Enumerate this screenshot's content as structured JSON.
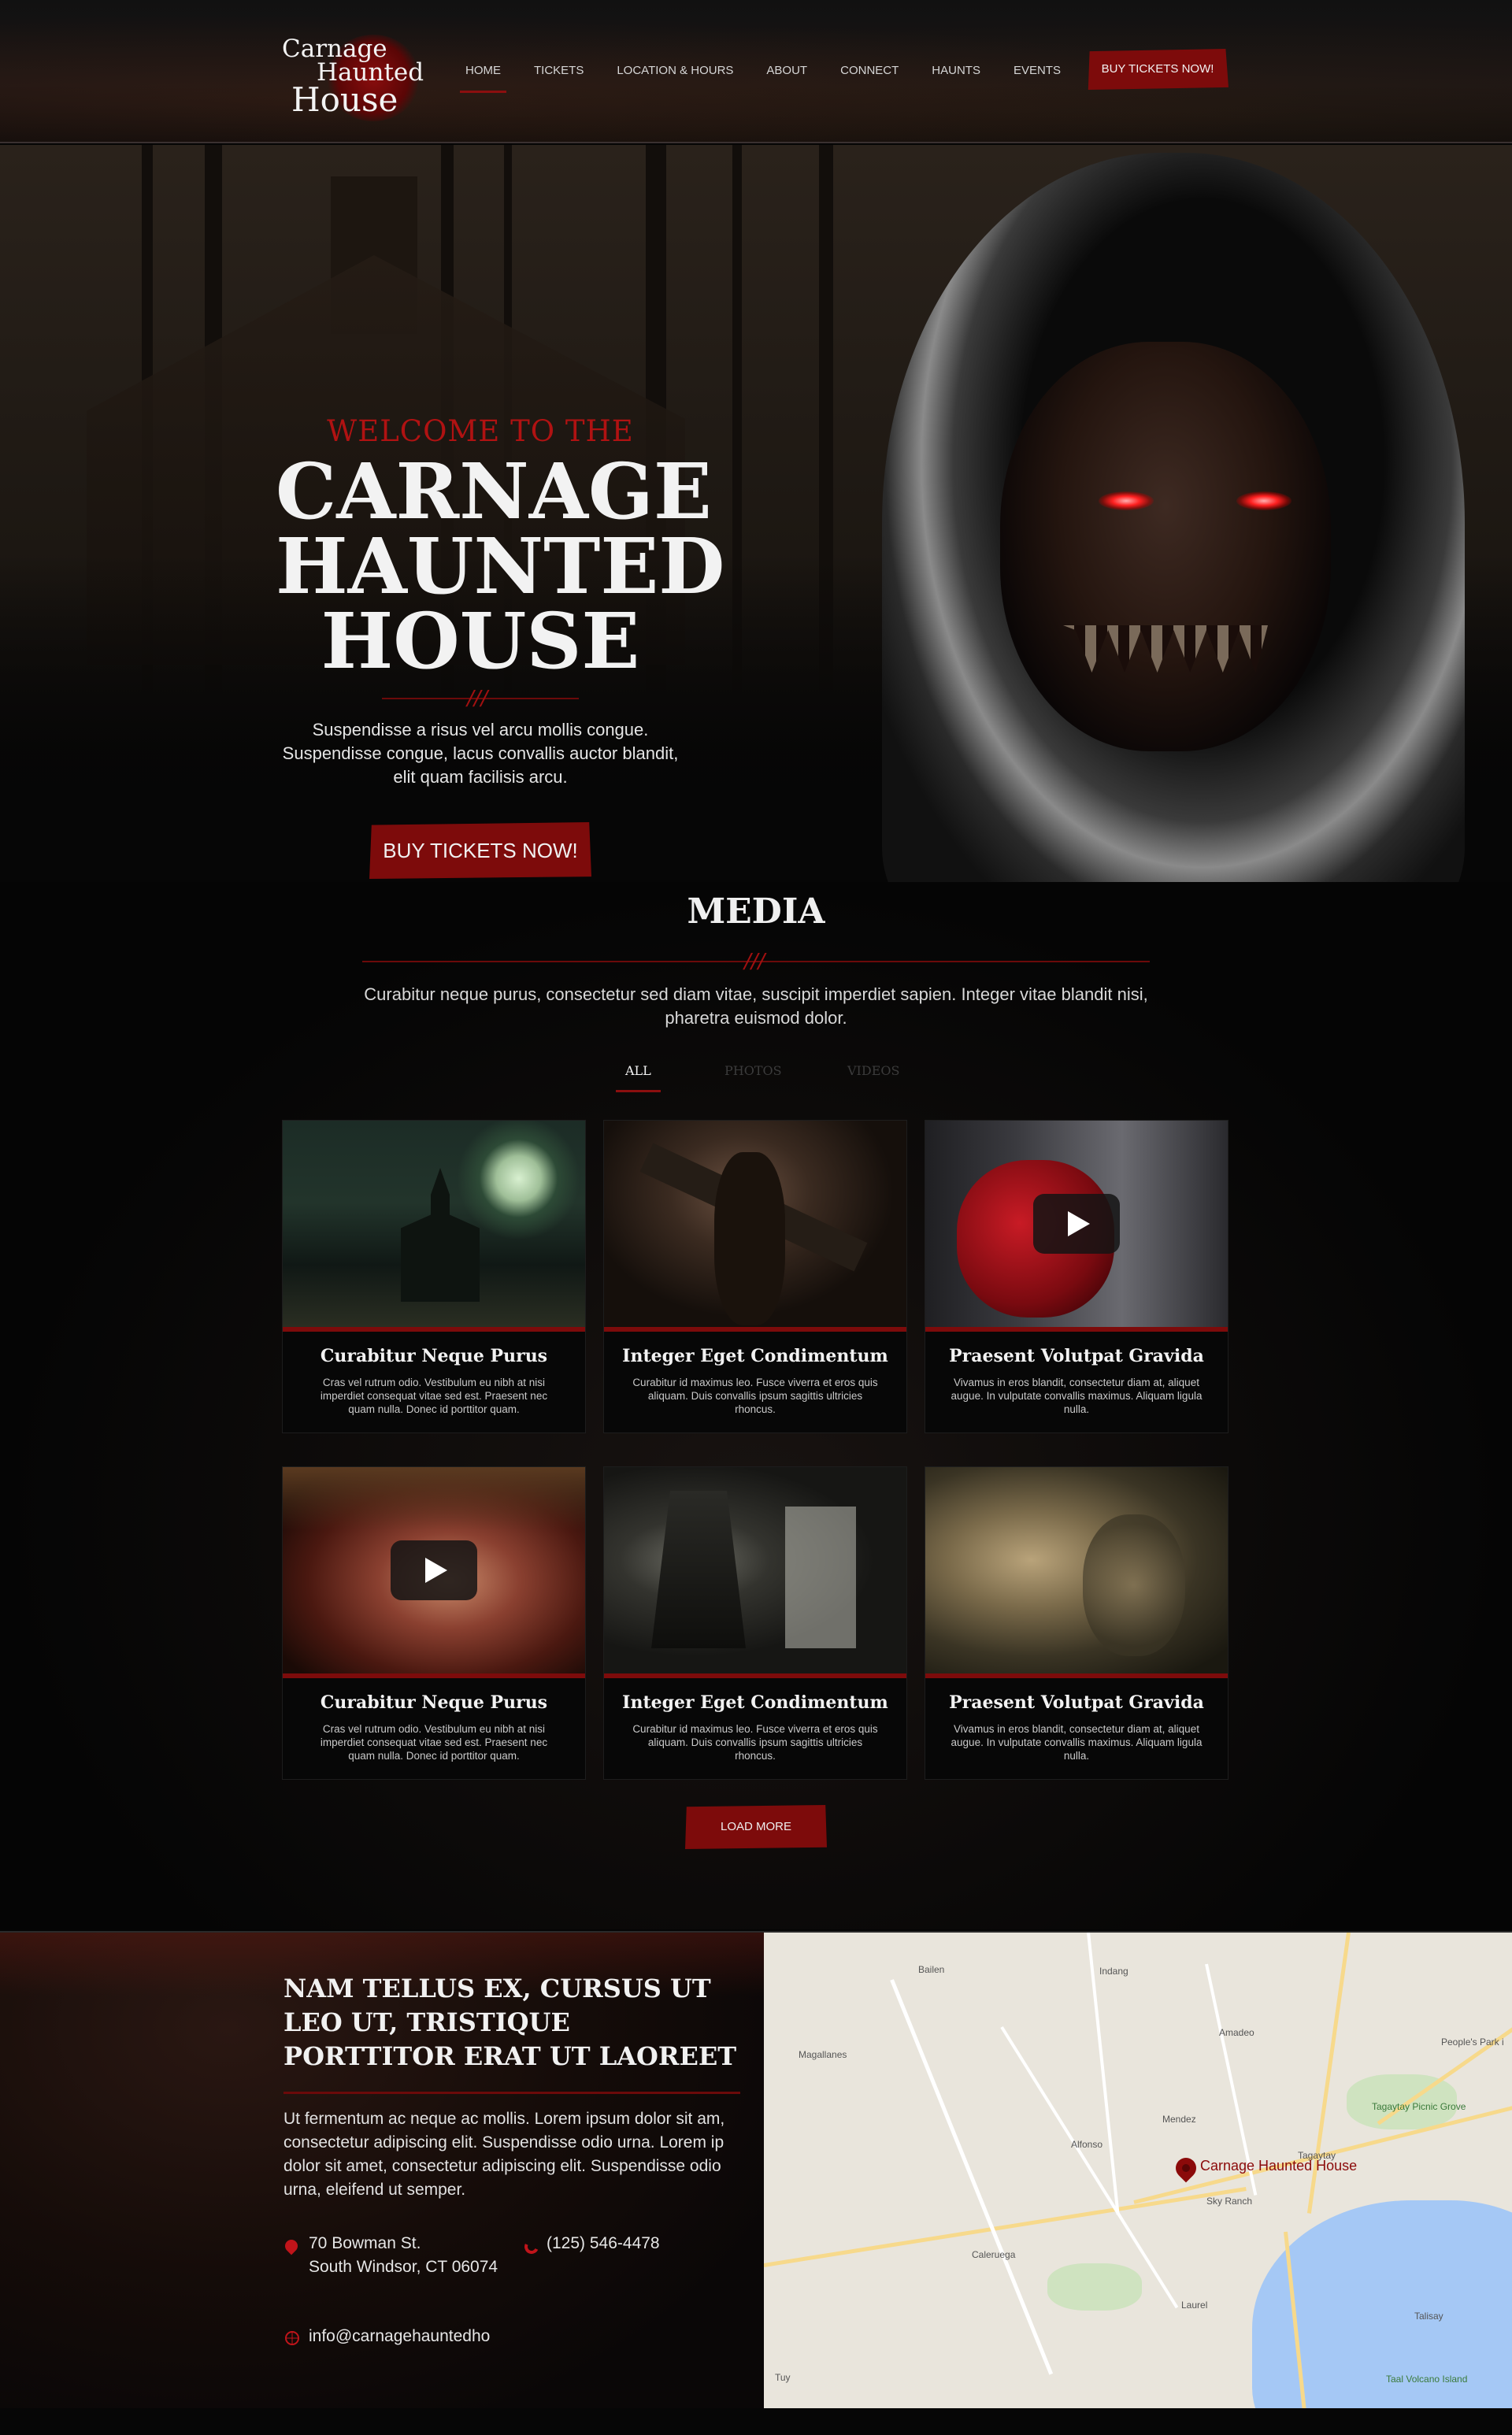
{
  "header": {
    "logo": {
      "line1": "Carnage",
      "line2": "Haunted",
      "line3": "House"
    },
    "nav": [
      "HOME",
      "TICKETS",
      "LOCATION & HOURS",
      "ABOUT",
      "CONNECT",
      "HAUNTS",
      "EVENTS"
    ],
    "buy_button": "BUY TICKETS NOW!"
  },
  "hero": {
    "kicker": "WELCOME TO THE",
    "title_lines": [
      "CARNAGE",
      "HAUNTED",
      "HOUSE"
    ],
    "divider_marks": "///",
    "description": "Suspendisse a risus vel arcu mollis congue. Suspendisse congue, lacus convallis auctor blandit, elit quam facilisis arcu.",
    "button": "BUY TICKETS NOW!"
  },
  "media": {
    "title": "MEDIA",
    "divider_marks": "///",
    "description": "Curabitur neque purus, consectetur sed diam vitae, suscipit imperdiet sapien. Integer vitae blandit nisi, pharetra euismod dolor.",
    "filters": [
      "ALL",
      "PHOTOS",
      "VIDEOS"
    ],
    "active_filter": "ALL",
    "items": [
      {
        "title": "Curabitur Neque Purus",
        "text": "Cras vel rutrum odio. Vestibulum eu nibh at nisi imperdiet consequat vitae sed est. Praesent nec quam nulla. Donec id porttitor quam.",
        "image": "haunted-mansion-moon",
        "video": false
      },
      {
        "title": "Integer Eget Condimentum",
        "text": "Curabitur id maximus leo. Fusce viverra et eros quis aliquam. Duis convallis ipsum sagittis ultricies rhoncus.",
        "image": "werewolf-cross",
        "video": false
      },
      {
        "title": "Praesent Volutpat Gravida",
        "text": "Vivamus in eros blandit, consectetur diam at, aliquet augue. In vulputate convallis maximus. Aliquam ligula nulla.",
        "image": "bloody-hand-door",
        "video": true
      },
      {
        "title": "Curabitur Neque Purus",
        "text": "Cras vel rutrum odio. Vestibulum eu nibh at nisi imperdiet consequat vitae sed est. Praesent nec quam nulla. Donec id porttitor quam.",
        "image": "zombie-face",
        "video": true
      },
      {
        "title": "Integer Eget Condimentum",
        "text": "Curabitur id maximus leo. Fusce viverra et eros quis aliquam. Duis convallis ipsum sagittis ultricies rhoncus.",
        "image": "dark-corridor",
        "video": false
      },
      {
        "title": "Praesent Volutpat Gravida",
        "text": "Vivamus in eros blandit, consectetur diam at, aliquet augue. In vulputate convallis maximus. Aliquam ligula nulla.",
        "image": "ghostly-faces",
        "video": false
      }
    ],
    "load_more": "LOAD MORE"
  },
  "contact": {
    "title": "NAM TELLUS EX, CURSUS UT LEO UT, TRISTIQUE PORTTITOR ERAT UT LAOREET",
    "text": "Ut fermentum ac neque ac mollis. Lorem ipsum dolor sit am, consectetur adipiscing elit. Suspendisse odio urna.  Lorem ip dolor sit amet, consectetur adipiscing elit. Suspendisse odio urna, eleifend ut semper.",
    "address_line1": "70 Bowman St.",
    "address_line2": "South Windsor, CT 06074",
    "phone": "(125) 546-4478",
    "email": "info@carnagehauntedho",
    "icons": [
      "location-pin-icon",
      "phone-icon",
      "globe-icon"
    ]
  },
  "map": {
    "marker_label": "Carnage Haunted House",
    "places": [
      "Bailen",
      "Indang",
      "Amadeo",
      "Magallanes",
      "Mendez",
      "Alfonso",
      "Tagaytay",
      "Sky Ranch",
      "Caleruega",
      "Laurel",
      "Talisay",
      "Tuy",
      "People's Park i",
      "Tagaytay Picnic Grove",
      "Taal Volcano Island"
    ]
  },
  "colors": {
    "accent": "#7d0b0b",
    "background": "#050505",
    "text": "#f2f2f2"
  }
}
